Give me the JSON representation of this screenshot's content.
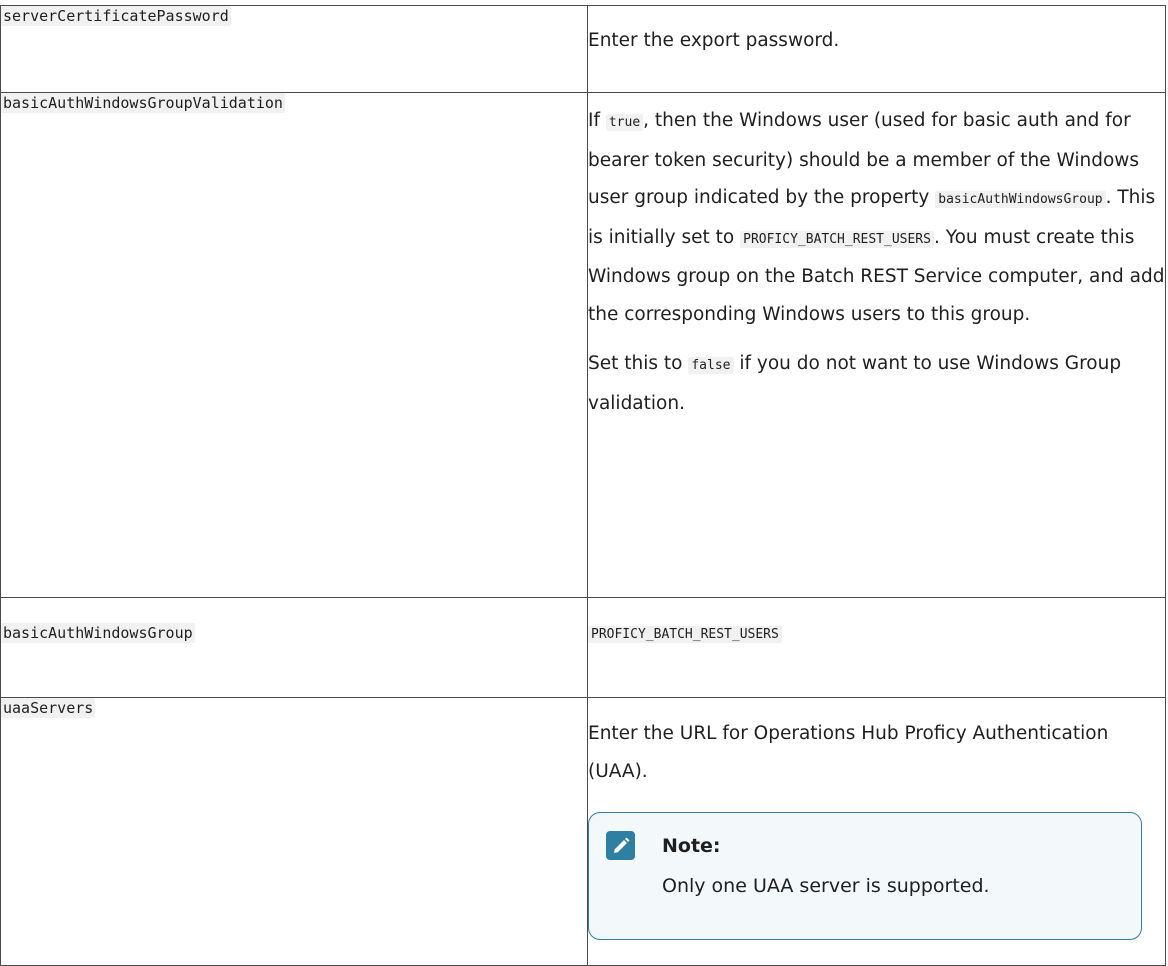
{
  "rows": [
    {
      "key": "serverCertificatePassword",
      "value": "Enter the export password."
    },
    {
      "key": "basicAuthWindowsGroupValidation",
      "p1": {
        "t1": "If ",
        "code1": "true",
        "t2": ", then the Windows user (used for ba­sic auth and for bearer token security) should be a member of the Windows user group indi­cated by the property ",
        "code2": "basicAuthWindowsGroup",
        "t3": ". This is initially set to ",
        "code3": "PROFICY_BATCH_REST_USERS",
        "t4": ". You must create this Windows group on the Batch REST Service computer, and add the cor­responding Windows users to this group."
      },
      "p2": {
        "t1": "Set this to ",
        "code1": "false",
        "t2": " if you do not want to use Win­dows Group validation."
      }
    },
    {
      "key": "basicAuthWindowsGroup",
      "value": "PROFICY_BATCH_REST_USERS"
    },
    {
      "key": "uaaServers",
      "value": "Enter the URL for Operations Hub Proficy Au­thentication (UAA).",
      "note": {
        "icon": "pencil-icon",
        "title": "Note:",
        "body": "Only one UAA server is supported."
      }
    }
  ],
  "colors": {
    "note_accent": "#2f7fa3",
    "code_bg": "#f1f1f1",
    "border": "#4a4a4a"
  }
}
